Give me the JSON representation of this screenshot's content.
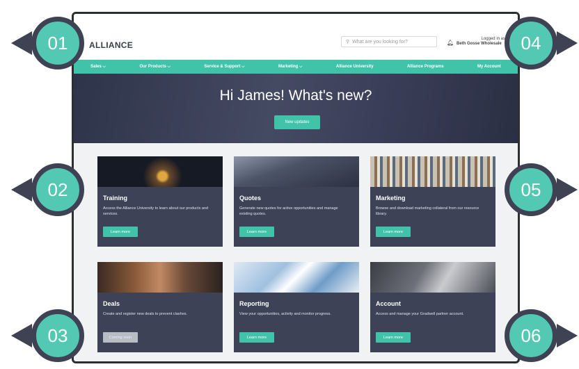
{
  "header": {
    "logo": "ALLIANCE",
    "search_placeholder": "What are you looking for?",
    "account_line1": "Logged in as",
    "account_line2": "Beth Gosse Wholesale"
  },
  "nav": [
    {
      "label": "Sales ⌵"
    },
    {
      "label": "Our Products ⌵"
    },
    {
      "label": "Service & Support ⌵"
    },
    {
      "label": "Marketing ⌵"
    },
    {
      "label": "Alliance University"
    },
    {
      "label": "Alliance Programs"
    },
    {
      "label": "My Account"
    }
  ],
  "hero": {
    "title": "Hi James! What's new?",
    "button": "New updates"
  },
  "cards": [
    {
      "title": "Training",
      "desc": "Access the Alliance University to learn about our products and services.",
      "button": "Learn more",
      "image": "lamp"
    },
    {
      "title": "Quotes",
      "desc": "Generate new quotes for active opportunities and manage existing quotes.",
      "button": "Learn more",
      "image": "calculator"
    },
    {
      "title": "Marketing",
      "desc": "Browse and download marketing collateral from our resource library.",
      "button": "Learn more",
      "image": "books"
    },
    {
      "title": "Deals",
      "desc": "Create and register new deals to prevent clashes.",
      "button": "Coming soon",
      "image": "team-hands"
    },
    {
      "title": "Reporting",
      "desc": "View your opportunities, activity and monitor progress.",
      "button": "Learn more",
      "image": "charts"
    },
    {
      "title": "Account",
      "desc": "Access and manage your Gradwell partner account.",
      "button": "Learn more",
      "image": "laptop"
    }
  ],
  "callouts": [
    "01",
    "02",
    "03",
    "04",
    "05",
    "06"
  ],
  "colors": {
    "accent": "#41c3aa",
    "card": "#3d4257",
    "callout_border": "#3e4252"
  }
}
